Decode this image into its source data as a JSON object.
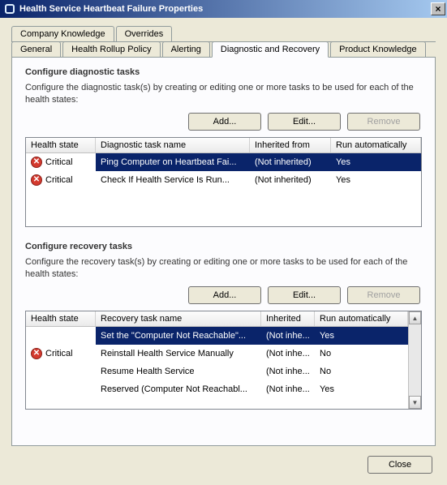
{
  "title": "Health Service Heartbeat Failure Properties",
  "close_glyph": "×",
  "tabs_row1": [
    "Company Knowledge",
    "Overrides"
  ],
  "tabs_row2": [
    "General",
    "Health Rollup Policy",
    "Alerting",
    "Diagnostic and Recovery",
    "Product Knowledge"
  ],
  "active_tab": "Diagnostic and Recovery",
  "diag": {
    "title": "Configure diagnostic tasks",
    "desc": "Configure the diagnostic task(s) by creating or editing one or more tasks to be used for each of the health states:",
    "buttons": {
      "add": "Add...",
      "edit": "Edit...",
      "remove": "Remove"
    },
    "headers": [
      "Health state",
      "Diagnostic task name",
      "Inherited from",
      "Run automatically"
    ],
    "rows": [
      {
        "state": "Critical",
        "name": "Ping Computer on Heartbeat Fai...",
        "inherited": "(Not inherited)",
        "auto": "Yes",
        "selected": true
      },
      {
        "state": "Critical",
        "name": "Check If Health Service Is Run...",
        "inherited": "(Not inherited)",
        "auto": "Yes",
        "selected": false
      }
    ]
  },
  "rec": {
    "title": "Configure recovery tasks",
    "desc": "Configure the recovery task(s) by creating or editing one or more tasks to be used for each of the health states:",
    "buttons": {
      "add": "Add...",
      "edit": "Edit...",
      "remove": "Remove"
    },
    "headers": [
      "Health state",
      "Recovery task name",
      "Inherited",
      "Run automatically"
    ],
    "rows": [
      {
        "state": "",
        "name": "Set the \"Computer Not Reachable\"...",
        "inherited": "(Not inhe...",
        "auto": "Yes",
        "selected": true
      },
      {
        "state": "Critical",
        "name": "Reinstall Health Service Manually",
        "inherited": "(Not inhe...",
        "auto": "No",
        "selected": false
      },
      {
        "state": "",
        "name": "Resume Health Service",
        "inherited": "(Not inhe...",
        "auto": "No",
        "selected": false
      },
      {
        "state": "",
        "name": "Reserved (Computer Not Reachabl...",
        "inherited": "(Not inhe...",
        "auto": "Yes",
        "selected": false
      }
    ]
  },
  "footer": {
    "close": "Close"
  },
  "crit_glyph": "✕",
  "scroll": {
    "up": "▲",
    "down": "▼"
  }
}
